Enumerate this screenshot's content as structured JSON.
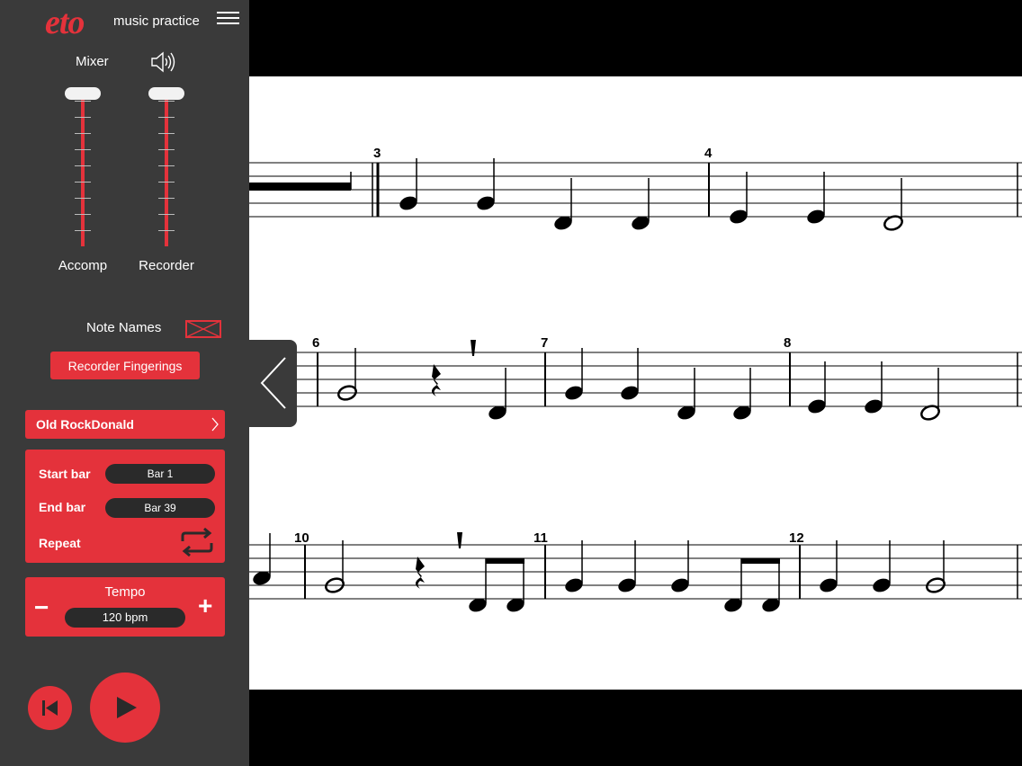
{
  "app": {
    "logo": "eto",
    "subtitle": "music practice",
    "accent_color": "#e4323b",
    "menu_icon": "hamburger-menu-icon"
  },
  "mixer": {
    "label": "Mixer",
    "speaker_icon": "speaker-icon",
    "faders": [
      {
        "label": "Accomp",
        "level": 1.0
      },
      {
        "label": "Recorder",
        "level": 1.0
      }
    ]
  },
  "options": {
    "note_names_label": "Note Names",
    "note_names_checked": false,
    "fingerings_button": "Recorder Fingerings"
  },
  "song": {
    "title": "Old RockDonald"
  },
  "range": {
    "start_label": "Start bar",
    "start_value": "Bar 1",
    "end_label": "End bar",
    "end_value": "Bar 39",
    "repeat_label": "Repeat"
  },
  "tempo": {
    "label": "Tempo",
    "value": "120 bpm",
    "minus": "−",
    "plus": "+"
  },
  "transport": {
    "rewind_icon": "skip-to-start-icon",
    "play_icon": "play-icon"
  },
  "score": {
    "bar_numbers": [
      "3",
      "4",
      "6",
      "7",
      "8",
      "10",
      "11",
      "12"
    ]
  }
}
